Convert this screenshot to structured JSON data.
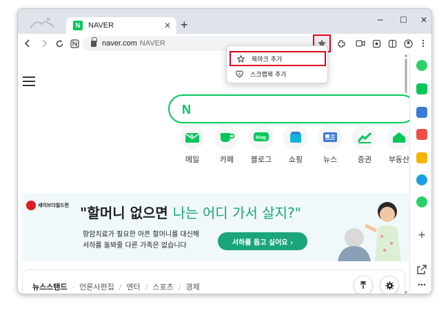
{
  "browser": {
    "tab_title": "NAVER",
    "tab_favicon_letter": "N",
    "new_tab_label": "+",
    "tab_close_label": "✕",
    "window_controls": [
      "─",
      "☐",
      "✕"
    ],
    "url_host": "naver.com",
    "url_page_title": "NAVER",
    "bookmark_icon": "star-plus-icon"
  },
  "bookmark_menu": {
    "items": [
      {
        "label": "북마크 추가",
        "icon": "star-icon",
        "highlighted": true
      },
      {
        "label": "스크랩북 추가",
        "icon": "scrapbook-icon",
        "highlighted": false
      }
    ]
  },
  "naver": {
    "logo_letter": "N",
    "services": [
      {
        "label": "메일",
        "icon": "mail-icon",
        "color": "#03c75a"
      },
      {
        "label": "카페",
        "icon": "cafe-icon",
        "color": "#03c75a"
      },
      {
        "label": "블로그",
        "icon": "blog-icon",
        "color": "#03c75a",
        "badge": "blog"
      },
      {
        "label": "쇼핑",
        "icon": "shopping-icon",
        "color": "#11b6d6"
      },
      {
        "label": "뉴스",
        "icon": "news-icon",
        "color": "#3a7bd5"
      },
      {
        "label": "증권",
        "icon": "stock-icon",
        "color": "#03c75a"
      },
      {
        "label": "부동산",
        "icon": "realestate-icon",
        "color": "#03c75a"
      }
    ],
    "banner": {
      "logo_text": "세이브더칠드런",
      "headline_part1": "\"할머니 없으면 ",
      "headline_part2": "나는 어디 가서 살지?\"",
      "sub_line1": "항암치료가 필요한 아픈 할머니를 대신해",
      "sub_line2": "서하를 돌봐줄 다른 가족은 없습니다",
      "button_label": "서하를 돕고 싶어요  ›",
      "accent_color": "#1aa57a"
    },
    "newsstand": {
      "tabs": [
        "뉴스스탠드",
        "언론사편집",
        "엔터",
        "스포츠",
        "경제"
      ],
      "top_button_icon": "arrow-up-icon",
      "settings_icon": "gear-icon"
    }
  },
  "colors": {
    "naver_green": "#03c75a",
    "highlight_red": "#e0001a"
  }
}
